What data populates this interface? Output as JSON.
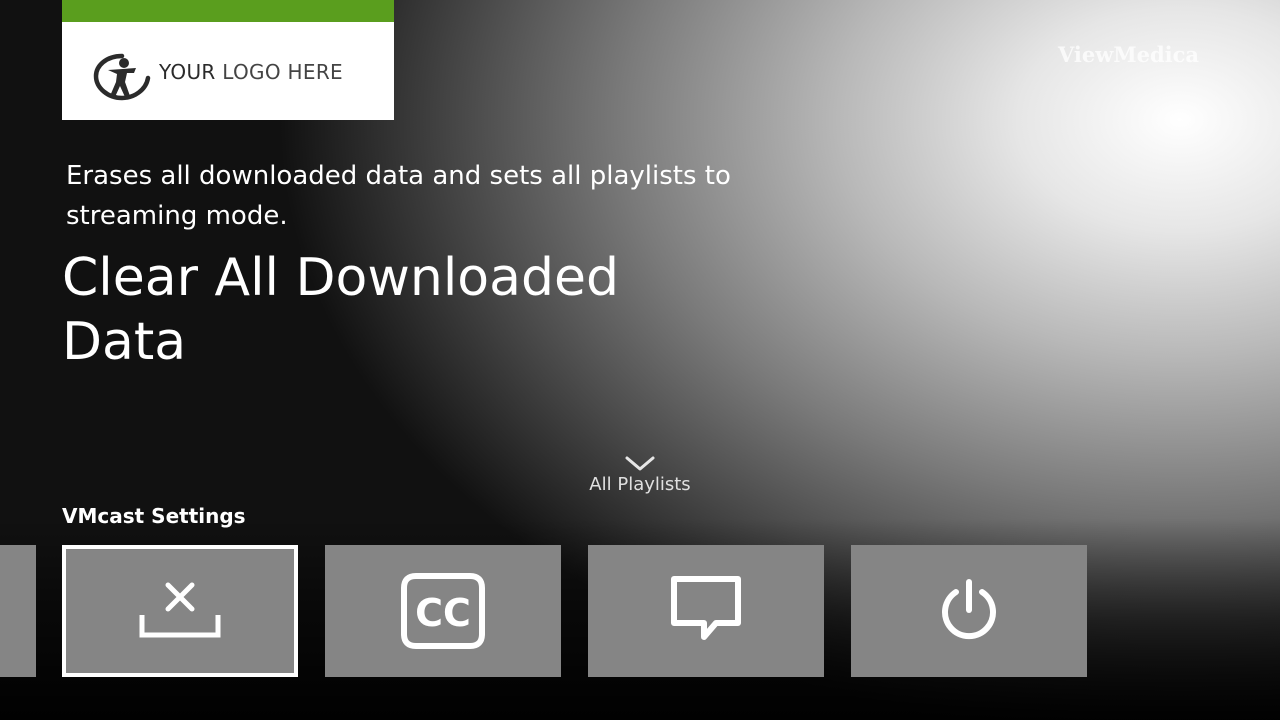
{
  "brand": {
    "name": "ViewMedica"
  },
  "logo": {
    "text_bold": "YOUR",
    "text_light": "LOGO HERE",
    "accent_color": "#5a9e1e"
  },
  "detail": {
    "description": "Erases all downloaded data and sets all playlists to streaming mode.",
    "title": "Clear All Downloaded Data"
  },
  "navigation": {
    "down_label": "All Playlists",
    "icon": "chevron-down-icon"
  },
  "settings_row": {
    "title": "VMcast Settings",
    "tiles": [
      {
        "name": "previous-tile",
        "icon": "none"
      },
      {
        "name": "clear-downloads-tile",
        "icon": "clear-download-icon",
        "selected": true
      },
      {
        "name": "closed-captions-tile",
        "icon": "closed-captions-icon"
      },
      {
        "name": "feedback-tile",
        "icon": "chat-bubble-icon"
      },
      {
        "name": "power-tile",
        "icon": "power-icon"
      }
    ]
  }
}
